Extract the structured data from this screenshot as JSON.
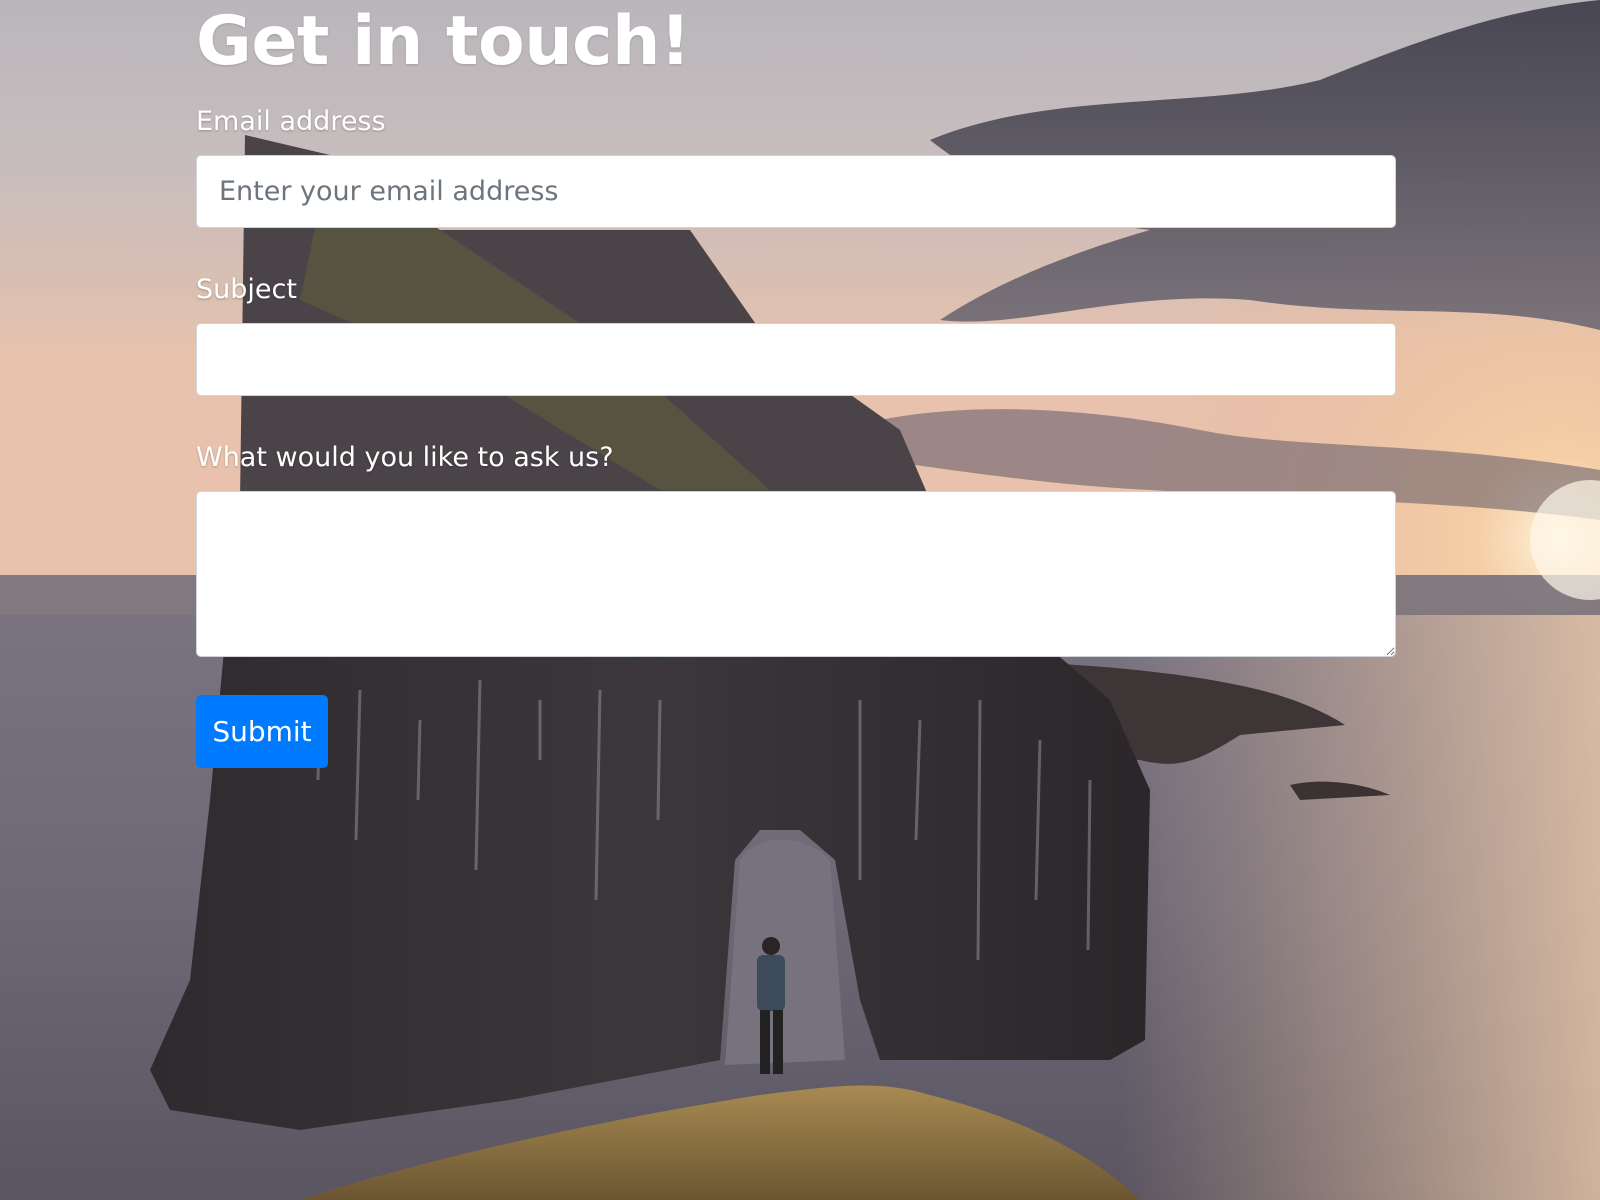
{
  "page": {
    "heading": "Get in touch!",
    "background_image": "sunset-sea-arch-landscape",
    "accent_color": "#007bff"
  },
  "form": {
    "email": {
      "label": "Email address",
      "placeholder": "Enter your email address",
      "value": ""
    },
    "subject": {
      "label": "Subject",
      "placeholder": "",
      "value": ""
    },
    "question": {
      "label": "What would you like to ask us?",
      "value": ""
    },
    "submit_label": "Submit"
  }
}
